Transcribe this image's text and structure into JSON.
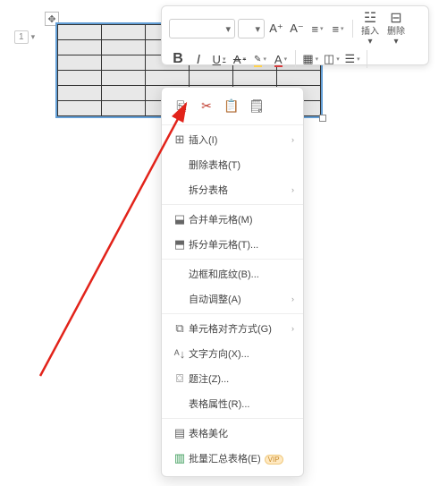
{
  "page_marker": "1",
  "toolbar": {
    "row1": {
      "font_inc": "A⁺",
      "font_dec": "A⁻",
      "insert": "插入",
      "delete": "删除"
    },
    "row2": {
      "bold": "B",
      "italic": "I",
      "underline": "U",
      "strike": "A",
      "highlight_letter": "A",
      "fontcolor_letter": "A"
    }
  },
  "ctx": {
    "icons": {
      "copy": "⎘",
      "cut": "✂",
      "paste": "📋",
      "paste_special": "🗒"
    },
    "insert": "插入(I)",
    "delete_table": "删除表格(T)",
    "split_table": "拆分表格",
    "merge_cells": "合并单元格(M)",
    "split_cells": "拆分单元格(T)...",
    "borders_shading": "边框和底纹(B)...",
    "autofit": "自动调整(A)",
    "cell_align": "单元格对齐方式(G)",
    "text_direction": "文字方向(X)...",
    "caption": "题注(Z)...",
    "table_props": "表格属性(R)...",
    "table_beautify": "表格美化",
    "batch_summary": "批量汇总表格(E)",
    "vip": "VIP"
  }
}
